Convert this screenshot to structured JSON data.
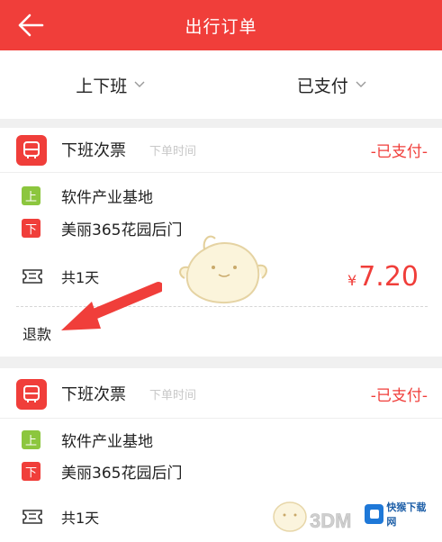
{
  "header": {
    "title": "出行订单"
  },
  "filters": [
    {
      "label": "上下班"
    },
    {
      "label": "已支付"
    }
  ],
  "orders": [
    {
      "ticket_type": "下班次票",
      "order_time": "下单时间",
      "status": "-已支付-",
      "stops": [
        {
          "badge": "上",
          "name": "软件产业基地"
        },
        {
          "badge": "下",
          "name": "美丽365花园后门"
        }
      ],
      "days": "共1天",
      "price_currency": "¥",
      "price": "7.20",
      "refund_label": "退款"
    },
    {
      "ticket_type": "下班次票",
      "order_time": "下单时间",
      "status": "-已支付-",
      "stops": [
        {
          "badge": "上",
          "name": "软件产业基地"
        },
        {
          "badge": "下",
          "name": "美丽365花园后门"
        }
      ],
      "days": "共1天"
    }
  ],
  "watermarks": {
    "logo_3dm": "3DM",
    "logo_kb": "快猴下载网"
  },
  "colors": {
    "brand_red": "#f03e3a",
    "board_green": "#8cc63e"
  },
  "icons": {
    "back": "arrow-left-icon",
    "dropdown": "chevron-down-icon",
    "bus": "bus-icon",
    "ticket": "ticket-icon"
  }
}
